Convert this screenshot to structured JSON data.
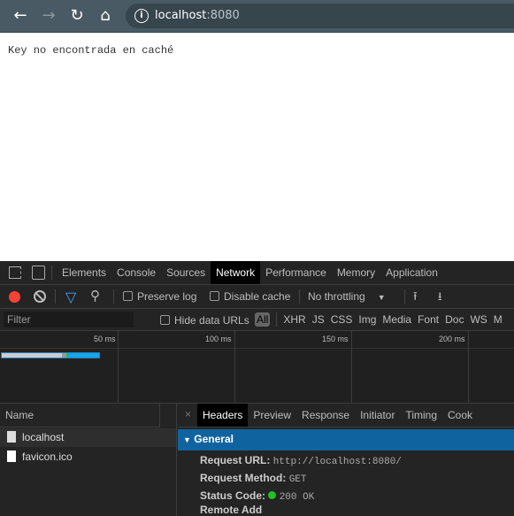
{
  "browser": {
    "url_host": "localhost",
    "url_port": ":8080"
  },
  "page": {
    "text": "Key no encontrada en caché"
  },
  "devtools": {
    "tabs": [
      "Elements",
      "Console",
      "Sources",
      "Network",
      "Performance",
      "Memory",
      "Application"
    ],
    "active_tab": "Network",
    "toolbar": {
      "preserve_log": "Preserve log",
      "disable_cache": "Disable cache",
      "throttling": "No throttling"
    },
    "filter": {
      "placeholder": "Filter",
      "hide_data_urls": "Hide data URLs",
      "types": [
        "All",
        "XHR",
        "JS",
        "CSS",
        "Img",
        "Media",
        "Font",
        "Doc",
        "WS",
        "M"
      ]
    },
    "timeline": {
      "ticks": [
        "50 ms",
        "100 ms",
        "150 ms",
        "200 ms"
      ]
    },
    "requests": {
      "header": "Name",
      "items": [
        "localhost",
        "favicon.ico"
      ]
    },
    "detail": {
      "tabs": [
        "Headers",
        "Preview",
        "Response",
        "Initiator",
        "Timing",
        "Cook"
      ],
      "section": "General",
      "rows": [
        {
          "label": "Request URL:",
          "value": "http://localhost:8080/"
        },
        {
          "label": "Request Method:",
          "value": "GET"
        },
        {
          "label": "Status Code:",
          "value": "200 OK"
        },
        {
          "label": "Remote Add",
          "value": ""
        }
      ]
    }
  },
  "colors": {
    "record": "#f44336",
    "status_ok": "#22c022",
    "accent": "#0f64a0",
    "filter_icon": "#4a9ff5"
  }
}
